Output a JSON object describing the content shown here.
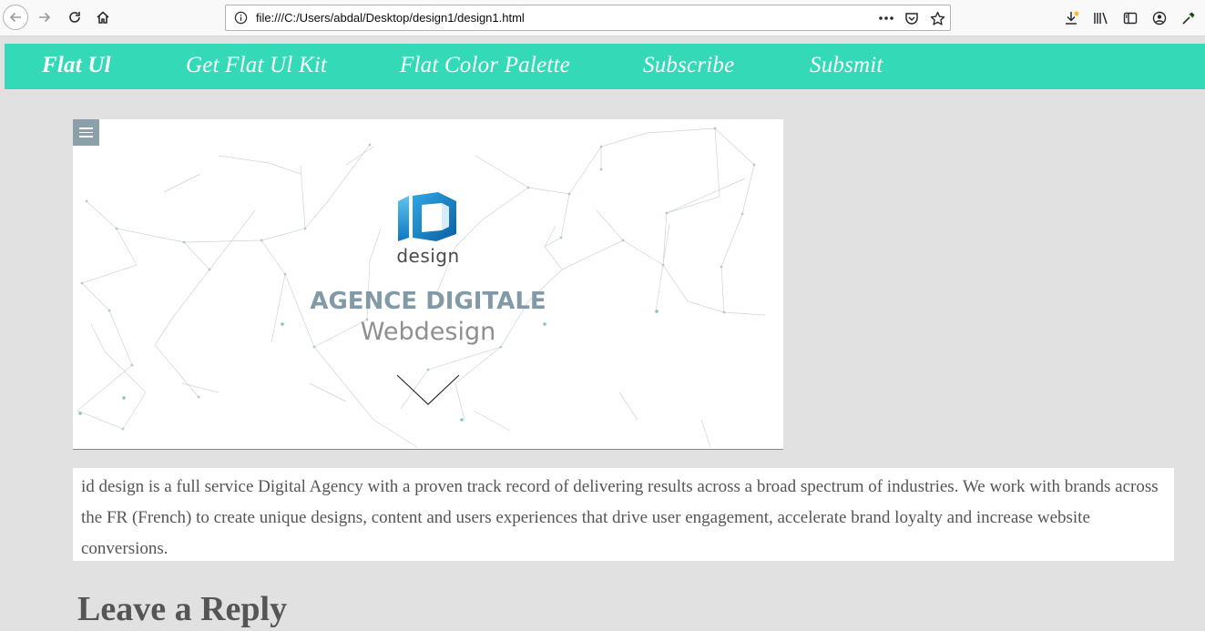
{
  "browser": {
    "url": "file:///C:/Users/abdal/Desktop/design1/design1.html",
    "icons": [
      "back-icon",
      "forward-icon",
      "reload-icon",
      "home-icon",
      "info-icon",
      "more-icon",
      "pocket-icon",
      "bookmark-star-icon",
      "downloads-icon",
      "library-icon",
      "sidebar-icon",
      "account-icon",
      "eyedropper-icon"
    ]
  },
  "nav": {
    "brand": "Flat Ul",
    "items": [
      {
        "label": "Get Flat Ul Kit"
      },
      {
        "label": "Flat Color Palette"
      },
      {
        "label": "Subscribe"
      },
      {
        "label": "Subsmit"
      }
    ],
    "color": "#34d9b7"
  },
  "hero": {
    "logo_word": "design",
    "title": "AGENCE DIGITALE",
    "subtitle": "Webdesign",
    "menu_icon": "hamburger-menu-icon",
    "scroll_icon": "chevron-down-icon"
  },
  "description": {
    "text": "id design is a full service Digital Agency with a proven track record of delivering results across a broad spectrum of industries. We work with brands across the FR (French) to create unique designs, content and users experiences that drive user engagement, accelerate brand loyalty and increase website conversions."
  },
  "reply": {
    "title": "Leave a Reply"
  }
}
